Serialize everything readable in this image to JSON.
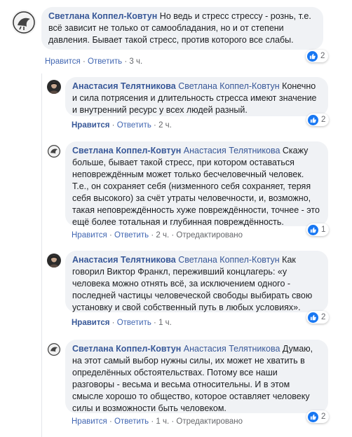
{
  "colors": {
    "author": "#385898",
    "bubble": "#f0f2f5",
    "like": "#1877f2",
    "meta": "#65676b"
  },
  "actions": {
    "like": "Нравится",
    "reply": "Ответить",
    "sep": " · ",
    "edited": "Отредактировано"
  },
  "comments": [
    {
      "author": "Светлана Коппел-Ковтун",
      "mention": "",
      "text": "Но ведь и стресс стрессу - рознь, т.е. всё зависит не только от самообладания, но и от степени давления. Бывает такой стресс, против которого все слабы.",
      "time": "3 ч.",
      "likes": "2",
      "avatar_icon": "dove-avatar-icon"
    },
    {
      "author": "Анастасия Телятникова",
      "mention": "Светлана Коппел-Ковтун",
      "text": "Конечно и сила потрясения и длительность стресса имеют значение и внутренний ресурс у всех людей разный.",
      "time": "2 ч.",
      "likes": "2",
      "avatar_icon": "profile-photo-icon"
    },
    {
      "author": "Светлана Коппел-Ковтун",
      "mention": "Анастасия Телятникова",
      "text": "Скажу больше, бывает такой стресс, при котором оставаться неповреждённым может только бесчеловечный человек. Т.е., он сохраняет себя (низменного себя сохраняет, теряя себя высокого) за счёт утраты человечности, и, возможно, такая неповреждённость хуже повреждённости, точнее - это ещё более тотальная и глубинная повреждённость.",
      "time": "2 ч.",
      "likes": "1",
      "avatar_icon": "dove-avatar-icon"
    },
    {
      "author": "Анастасия Телятникова",
      "mention": "Светлана Коппел-Ковтун",
      "text": "Как говорил Виктор Франкл, переживший концлагерь: «у человека можно отнять всё, за исключением одного - последней частицы человеческой свободы выбирать свою установку и свой собственный путь в любых условиях».",
      "time": "1 ч.",
      "likes": "2",
      "avatar_icon": "profile-photo-icon"
    },
    {
      "author": "Светлана Коппел-Ковтун",
      "mention": "Анастасия Телятникова",
      "text": "Думаю, на этот самый выбор нужны силы, их может не хватить в определённых обстоятельствах. Потому все наши разговоры - весьма и весьма относительны. И в этом смысле хорошо то общество, которое оставляет человеку силы и возможности быть человеком.",
      "time": "1 ч.",
      "likes": "2",
      "avatar_icon": "dove-avatar-icon"
    }
  ]
}
